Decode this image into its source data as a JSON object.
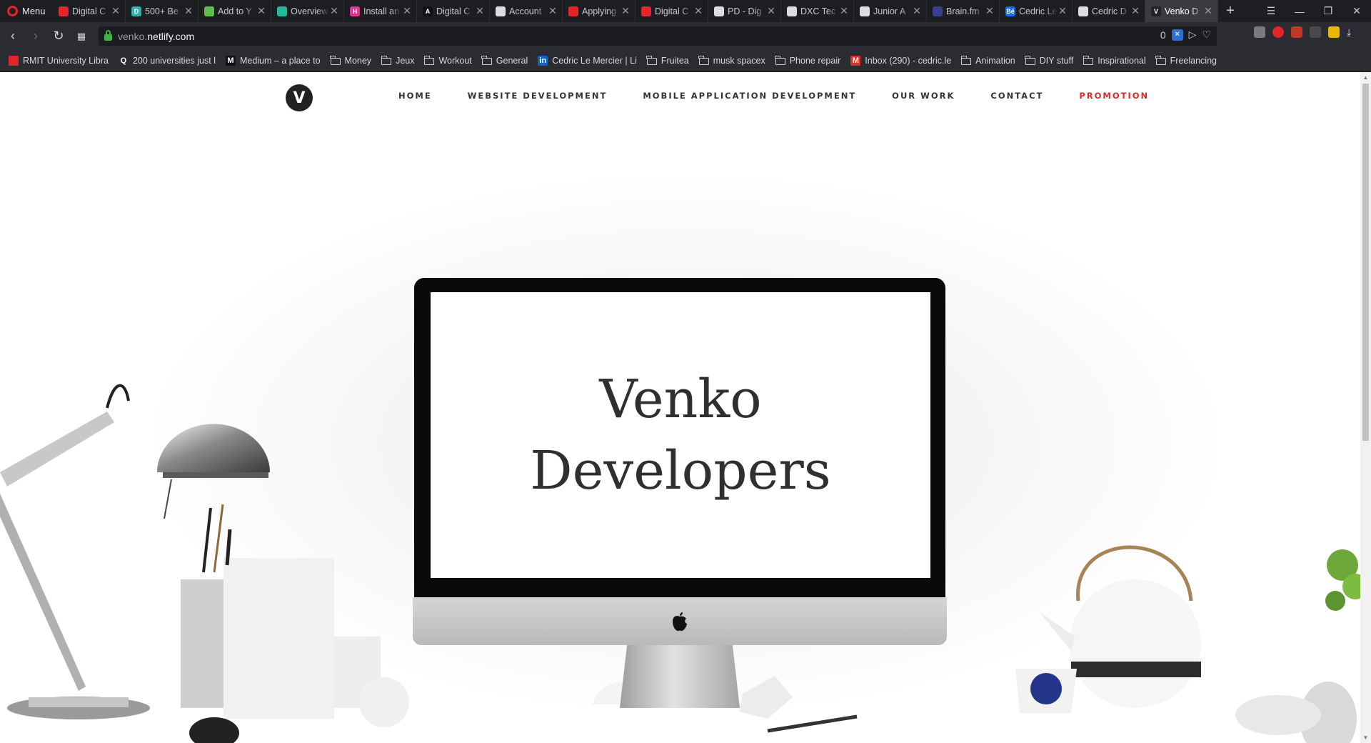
{
  "browser": {
    "menu_label": "Menu",
    "tabs": [
      {
        "title": "Digital C",
        "favicon_color": "#e3242b",
        "favicon_text": ""
      },
      {
        "title": "500+ Be",
        "favicon_color": "#2bb3a8",
        "favicon_text": "D"
      },
      {
        "title": "Add to Y",
        "favicon_color": "#5fbd4a",
        "favicon_text": ""
      },
      {
        "title": "Overview",
        "favicon_color": "#26b7a0",
        "favicon_text": ""
      },
      {
        "title": "Install an",
        "favicon_color": "#e5318f",
        "favicon_text": "H"
      },
      {
        "title": "Digital C",
        "favicon_color": "#111111",
        "favicon_text": "A"
      },
      {
        "title": "Account",
        "favicon_color": "#dcdcdc",
        "favicon_text": ""
      },
      {
        "title": "Applying",
        "favicon_color": "#e3242b",
        "favicon_text": ""
      },
      {
        "title": "Digital C",
        "favicon_color": "#e3242b",
        "favicon_text": ""
      },
      {
        "title": "PD - Dig",
        "favicon_color": "#dddddd",
        "favicon_text": ""
      },
      {
        "title": "DXC Tec",
        "favicon_color": "#dcdcdc",
        "favicon_text": ""
      },
      {
        "title": "Junior A",
        "favicon_color": "#dcdcdc",
        "favicon_text": ""
      },
      {
        "title": "Brain.fm",
        "favicon_color": "#3b3f8f",
        "favicon_text": ""
      },
      {
        "title": "Cedric Le",
        "favicon_color": "#1769ff",
        "favicon_text": "Bē"
      },
      {
        "title": "Cedric D",
        "favicon_color": "#dddddd",
        "favicon_text": ""
      },
      {
        "title": "Venko D",
        "favicon_color": "#222222",
        "favicon_text": "V",
        "active": true
      }
    ],
    "url_domain_prefix": "venko.",
    "url_domain_main": "netlify.com",
    "adblock_count": "0",
    "bookmarks": [
      {
        "label": "RMIT University Libra",
        "type": "site",
        "icon_color": "#e3242b",
        "icon_text": ""
      },
      {
        "label": "200 universities just l",
        "type": "site",
        "icon_color": "#2b2c31",
        "icon_text": "Q"
      },
      {
        "label": "Medium – a place to",
        "type": "site",
        "icon_color": "#111111",
        "icon_text": "M"
      },
      {
        "label": "Money",
        "type": "folder"
      },
      {
        "label": "Jeux",
        "type": "folder"
      },
      {
        "label": "Workout",
        "type": "folder"
      },
      {
        "label": "General",
        "type": "folder"
      },
      {
        "label": "Cedric Le Mercier | Li",
        "type": "site",
        "icon_color": "#0a66c2",
        "icon_text": "in"
      },
      {
        "label": "Fruitea",
        "type": "folder"
      },
      {
        "label": "musk spacex",
        "type": "folder"
      },
      {
        "label": "Phone repair",
        "type": "folder"
      },
      {
        "label": "Inbox (290) - cedric.le",
        "type": "site",
        "icon_color": "#d93025",
        "icon_text": "M"
      },
      {
        "label": "Animation",
        "type": "folder"
      },
      {
        "label": "DIY stuff",
        "type": "folder"
      },
      {
        "label": "Inspirational",
        "type": "folder"
      },
      {
        "label": "Freelancing",
        "type": "folder"
      }
    ]
  },
  "site": {
    "logo_letter": "V",
    "nav": [
      {
        "label": "HOME"
      },
      {
        "label": "WEBSITE DEVELOPMENT"
      },
      {
        "label": "MOBILE APPLICATION DEVELOPMENT"
      },
      {
        "label": "OUR WORK"
      },
      {
        "label": "CONTACT"
      },
      {
        "label": "PROMOTION",
        "highlight": true
      }
    ],
    "hero_title_line1": "Venko",
    "hero_title_line2": "Developers",
    "colors": {
      "promo": "#d22e2e",
      "text": "#333333"
    }
  }
}
